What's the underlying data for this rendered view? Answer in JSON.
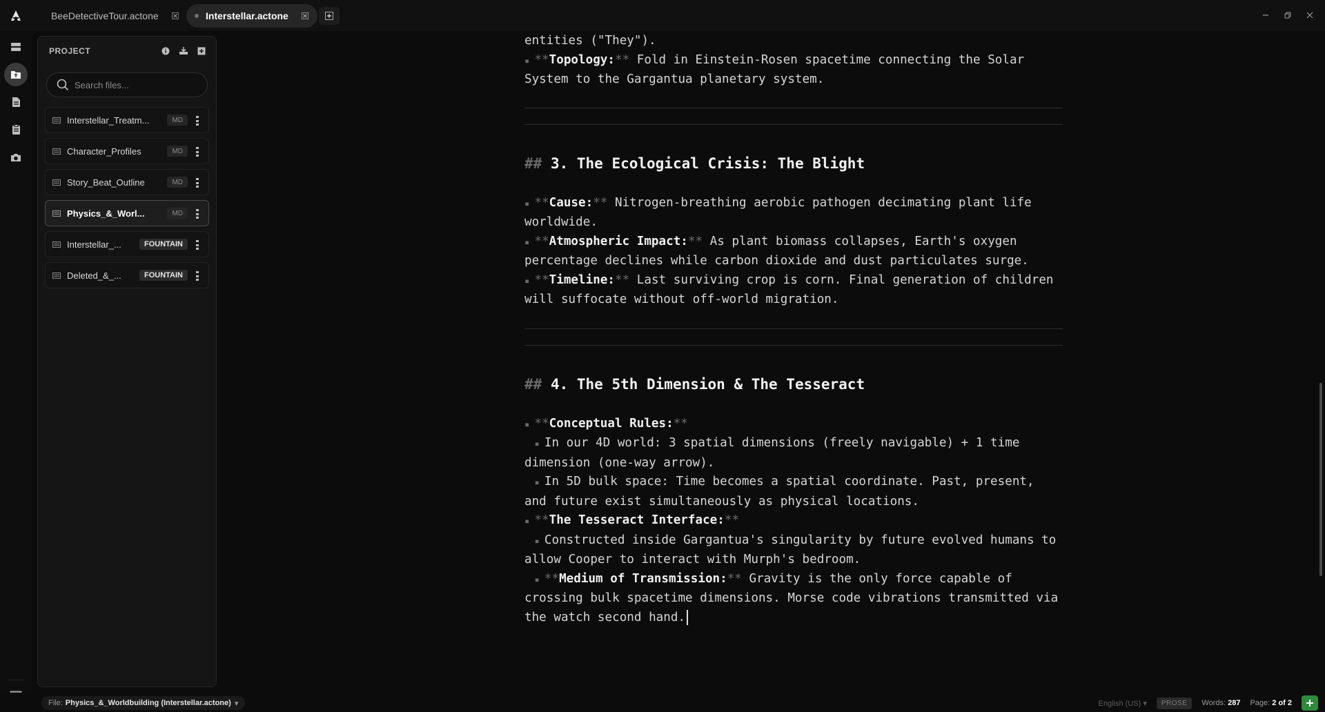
{
  "tabs": [
    {
      "label": "BeeDetectiveTour.actone",
      "active": false
    },
    {
      "label": "Interstellar.actone",
      "active": true
    }
  ],
  "panel": {
    "title": "PROJECT",
    "search_placeholder": "Search files...",
    "files": [
      {
        "name": "Interstellar_Treatm...",
        "badge": "MD"
      },
      {
        "name": "Character_Profiles",
        "badge": "MD"
      },
      {
        "name": "Story_Beat_Outline",
        "badge": "MD"
      },
      {
        "name": "Physics_&_Worl...",
        "badge": "MD",
        "active": true
      },
      {
        "name": "Interstellar_...",
        "badge": "FOUNTAIN"
      },
      {
        "name": "Deleted_&_...",
        "badge": "FOUNTAIN"
      }
    ]
  },
  "editor": {
    "l1": "entities (\"They\").",
    "topology_key": "Topology:",
    "topology_text": " Fold in Einstein-Rosen spacetime connecting the Solar System to the Gargantua planetary system.",
    "h3_mark": "##",
    "h3": " 3. The Ecological Crisis: The Blight",
    "cause_key": "Cause:",
    "cause_text": " Nitrogen-breathing aerobic pathogen decimating plant life worldwide.",
    "atmo_key": "Atmospheric Impact:",
    "atmo_text": " As plant biomass collapses, Earth's oxygen percentage declines while carbon dioxide and dust particulates surge.",
    "timeline_key": "Timeline:",
    "timeline_text": " Last surviving crop is corn. Final generation of children will suffocate without off-world migration.",
    "h4_mark": "##",
    "h4": " 4. The 5th Dimension & The Tesseract",
    "rules_key": "Conceptual Rules:",
    "rules_a": "In our 4D world: 3 spatial dimensions (freely navigable) + 1 time dimension (one-way arrow).",
    "rules_b": "In 5D bulk space: Time becomes a spatial coordinate. Past, present, and future exist simultaneously as physical locations.",
    "tess_key": "The Tesseract Interface:",
    "tess_a": "Constructed inside Gargantua's singularity by future evolved humans to allow Cooper to interact with Murph's bedroom.",
    "medium_key": "Medium of Transmission:",
    "medium_text": " Gravity is the only force capable of crossing bulk spacetime dimensions. Morse code vibrations transmitted via the watch second hand.",
    "bold_mark": "**"
  },
  "status": {
    "file_prefix": "File:",
    "file_name": "Physics_&_Worldbuilding (Interstellar.actone)",
    "file_caret": "▾",
    "language": "English (US)",
    "language_caret": "▾",
    "mode": "PROSE",
    "words_label": "Words:",
    "words": "287",
    "page_label": "Page:",
    "page": "2 of 2"
  },
  "icons": {
    "logo": "actone-logo-icon",
    "rail": [
      "layers-icon",
      "folder-icon",
      "document-icon",
      "clipboard-icon",
      "camera-icon",
      "keyboard-icon"
    ]
  },
  "colors": {
    "accent_green": "#2f8a3e",
    "background": "#0c0c0c",
    "panel": "#151515"
  }
}
